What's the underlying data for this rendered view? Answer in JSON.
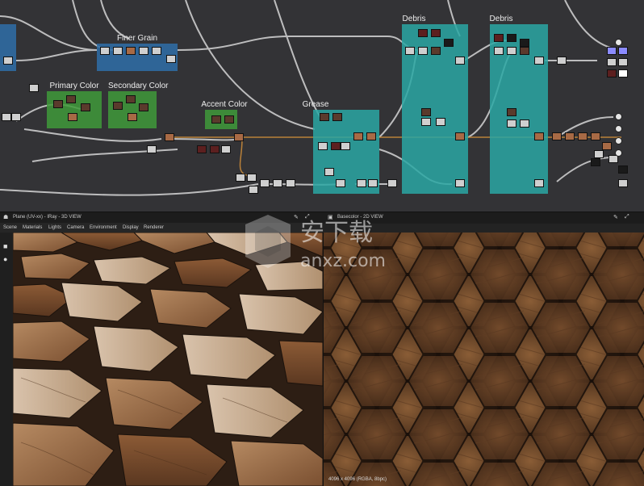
{
  "graph": {
    "frames": {
      "finer_grain": "Finer Grain",
      "primary_color": "Primary Color",
      "secondary_color": "Secondary Color",
      "accent_color": "Accent Color",
      "grease": "Grease",
      "debris_1": "Debris",
      "debris_2": "Debris"
    },
    "colors": {
      "background": "#333336",
      "blue_frame": "#2f6fa8",
      "green_frame": "#3f9a3a",
      "teal_frame": "#2aa7a3",
      "wire": "#d8d8d8",
      "wire_orange": "#c98a3a"
    }
  },
  "view3d": {
    "title": "Plane (UV-xx) - IRay - 3D VIEW",
    "menu": [
      "Scene",
      "Materials",
      "Lights",
      "Camera",
      "Environment",
      "Display",
      "Renderer"
    ],
    "tools": [
      "camera-icon",
      "light-icon"
    ]
  },
  "view2d": {
    "title": "Basecolor - 2D VIEW",
    "status": "4096 x 4096 (RGBA, 8bpc)"
  },
  "watermark": {
    "text_cn": "安下载",
    "text_en": "anxz.com"
  }
}
